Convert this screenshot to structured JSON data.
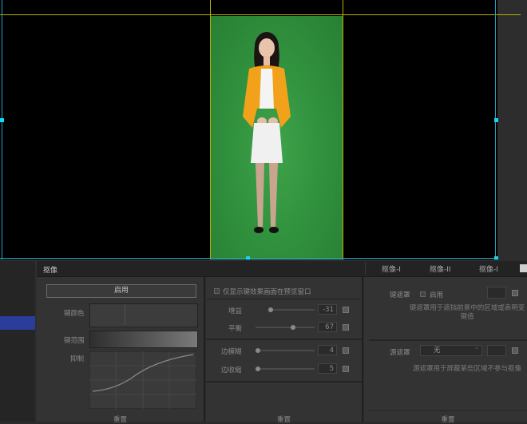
{
  "panel": {
    "title": "抠像",
    "tabs": [
      "抠像-I",
      "抠像-II",
      "抠像-I"
    ]
  },
  "left_column": {
    "enable_button": "启用",
    "key_color_label": "键颜色",
    "key_range_label": "键范围",
    "suppress_label": "抑制",
    "reset_label": "重置"
  },
  "middle_column": {
    "preview_checkbox_label": "仅显示键效果画面在预览窗口",
    "sliders": [
      {
        "name": "gain",
        "label": "增益",
        "value": "-31"
      },
      {
        "name": "balance",
        "label": "平衡",
        "value": "67"
      }
    ],
    "edge_sliders": [
      {
        "name": "edge-blur",
        "label": "边模糊",
        "value": "4"
      },
      {
        "name": "edge-shrink",
        "label": "边收缩",
        "value": "5"
      }
    ],
    "reset_label": "重置"
  },
  "right_column": {
    "key_mask_label": "键遮罩",
    "enable_label": "启用",
    "key_mask_desc": "键遮罩用于遮挡前景中的区域或表明变键值",
    "source_mask_label": "源遮罩",
    "source_mask_value": "无",
    "source_mask_desc": "源遮罩用于屏蔽某些区域不参与抠像",
    "reset_label": "重置"
  },
  "colors": {
    "accent_blue": "#2a3d9a",
    "guide_yellow": "#b8b000",
    "handle_cyan": "#19d4f4",
    "green_screen": "#2f8f3c"
  }
}
